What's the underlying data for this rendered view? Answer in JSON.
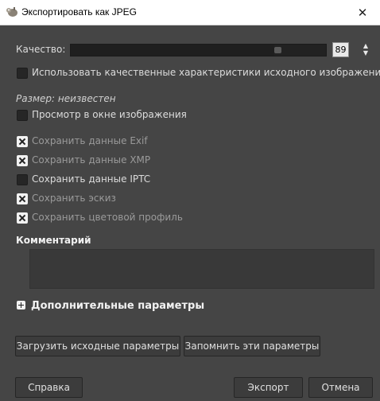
{
  "window": {
    "title": "Экспортировать как JPEG",
    "close_glyph": "✕"
  },
  "quality": {
    "label": "Качество:",
    "value": "89",
    "fraction": 0.89
  },
  "use_original_quality": {
    "label": "Использовать качественные характеристики исходного изображения",
    "checked": false
  },
  "size_info": "Размер: неизвестен",
  "preview": {
    "label": "Просмотр в окне изображения",
    "checked": false
  },
  "options": [
    {
      "label": "Сохранить данные Exif",
      "checked": true,
      "disabled": true
    },
    {
      "label": "Сохранить данные XMP",
      "checked": true,
      "disabled": true
    },
    {
      "label": "Сохранить данные IPTC",
      "checked": false,
      "disabled": false
    },
    {
      "label": "Сохранить эскиз",
      "checked": true,
      "disabled": true
    },
    {
      "label": "Сохранить цветовой профиль",
      "checked": true,
      "disabled": true
    }
  ],
  "comment": {
    "label": "Комментарий",
    "value": ""
  },
  "advanced": {
    "label": "Дополнительные параметры"
  },
  "buttons": {
    "load_defaults": "Загрузить исходные параметры",
    "save_defaults": "Запомнить эти параметры",
    "help": "Справка",
    "export": "Экспорт",
    "cancel": "Отмена"
  },
  "icons": {
    "app": "gimp-wilber-icon",
    "close": "close-icon",
    "spin": "spin-arrows-icon",
    "expander": "plus-expander-icon"
  },
  "colors": {
    "dialog_bg": "#454545",
    "titlebar_bg": "#ffffff",
    "button_bg": "#3c3c3c",
    "text": "#dcdcdc",
    "disabled_text": "#9a9a9a"
  }
}
